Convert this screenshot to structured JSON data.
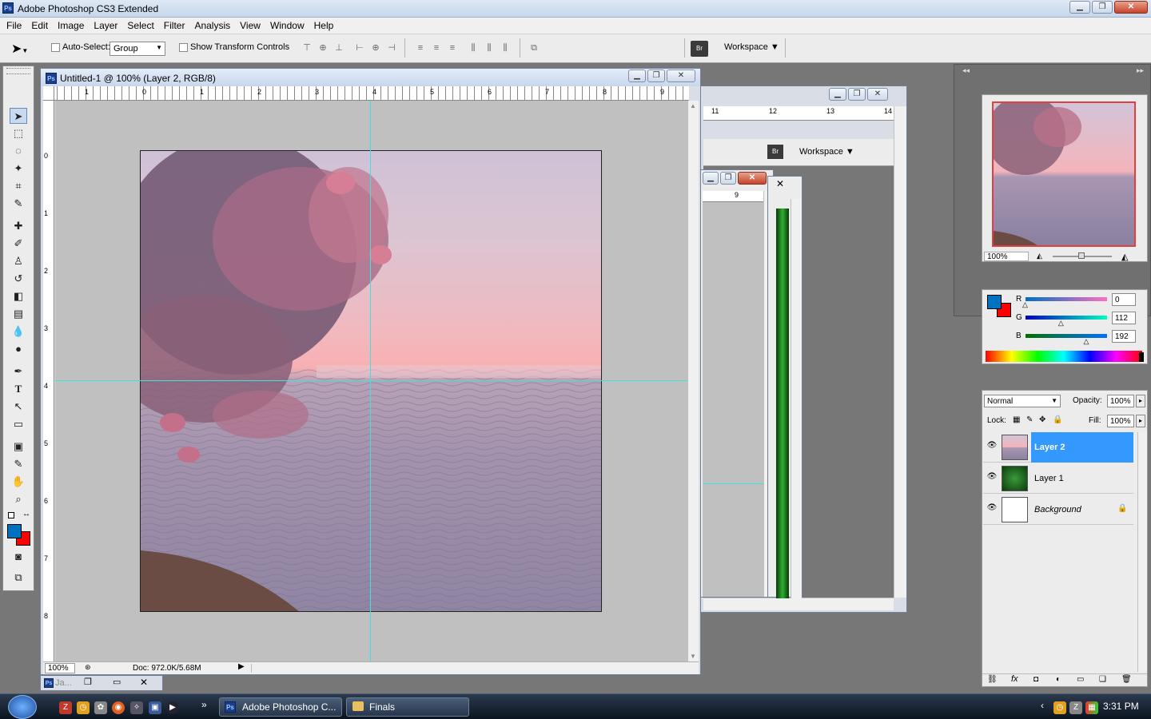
{
  "app": {
    "title": "Adobe Photoshop CS3 Extended",
    "ps_label": "Ps"
  },
  "menu": [
    "File",
    "Edit",
    "Image",
    "Layer",
    "Select",
    "Filter",
    "Analysis",
    "View",
    "Window",
    "Help"
  ],
  "options": {
    "auto_select_label": "Auto-Select:",
    "auto_select_value": "Group",
    "show_transform_label": "Show Transform Controls",
    "workspace_label": "Workspace",
    "bridge_label": "Br"
  },
  "document": {
    "title": "Untitled-1 @ 100% (Layer 2, RGB/8)",
    "zoom": "100%",
    "doc_size": "Doc: 972.0K/5.68M",
    "ruler_h": [
      "1",
      "0",
      "1",
      "2",
      "3",
      "4",
      "5",
      "6",
      "7",
      "8",
      "9"
    ],
    "ruler_v": [
      "0",
      "1",
      "2",
      "3",
      "4",
      "5",
      "6",
      "7",
      "8"
    ]
  },
  "back_document": {
    "ruler_h": [
      "11",
      "12",
      "13",
      "14"
    ],
    "workspace_label": "Workspace",
    "small_ruler": "9"
  },
  "minimized_doc": {
    "label": "Ja..."
  },
  "navigator": {
    "zoom": "100%"
  },
  "color_panel": {
    "r_label": "R",
    "g_label": "G",
    "b_label": "B",
    "r_value": "0",
    "g_value": "112",
    "b_value": "192",
    "r_level": 0.0,
    "g_level": 0.44,
    "b_level": 0.75,
    "foreground": "#0070c0",
    "background": "#ff0000"
  },
  "layers_panel": {
    "blend_mode": "Normal",
    "opacity_label": "Opacity:",
    "opacity": "100%",
    "lock_label": "Lock:",
    "fill_label": "Fill:",
    "fill": "100%",
    "layers": [
      {
        "name": "Layer 2",
        "selected": true
      },
      {
        "name": "Layer 1",
        "selected": false
      },
      {
        "name": "Background",
        "selected": false
      }
    ]
  },
  "taskbar": {
    "tasks": [
      "Adobe Photoshop C...",
      "Finals"
    ],
    "time": "3:31 PM",
    "overflow": "»"
  },
  "colors": {
    "selection": "#3399ff",
    "guide": "#3fe0e0"
  }
}
